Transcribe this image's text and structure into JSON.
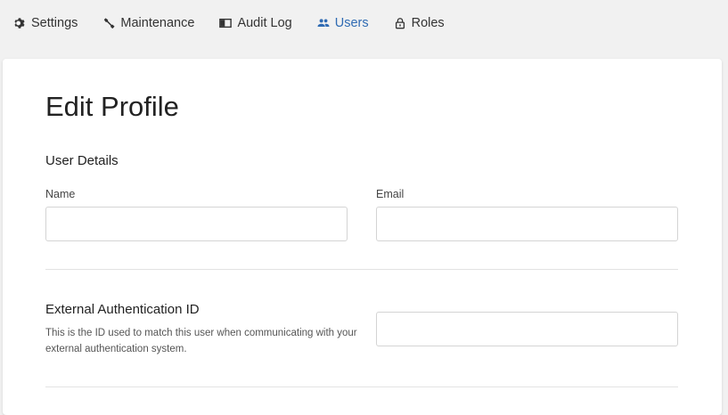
{
  "nav": {
    "items": [
      {
        "label": "Settings",
        "icon": "gear-icon",
        "active": false
      },
      {
        "label": "Maintenance",
        "icon": "wrench-icon",
        "active": false
      },
      {
        "label": "Audit Log",
        "icon": "book-icon",
        "active": false
      },
      {
        "label": "Users",
        "icon": "users-icon",
        "active": true
      },
      {
        "label": "Roles",
        "icon": "lock-icon",
        "active": false
      }
    ],
    "active_color": "#2f6bb3"
  },
  "main": {
    "page_title": "Edit Profile",
    "user_details": {
      "title": "User Details",
      "name_label": "Name",
      "name_value": "",
      "email_label": "Email",
      "email_value": ""
    },
    "external_auth": {
      "title": "External Authentication ID",
      "description": "This is the ID used to match this user when communicating with your external authentication system.",
      "value": ""
    }
  }
}
